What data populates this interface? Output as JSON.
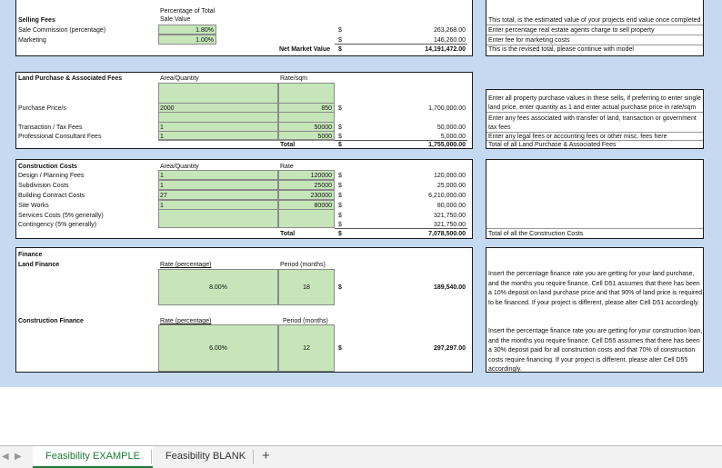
{
  "selling": {
    "col_header": [
      "Percentage of Total",
      "Sale Value"
    ],
    "title": "Selling Fees",
    "rows": [
      {
        "label": "Sale Commission (percentage)",
        "rate": "1.80%",
        "cur": "$",
        "amount": "263,268.00",
        "note": "Enter percentage real estate agents charge to sell property"
      },
      {
        "label": "Marketing",
        "rate": "1.00%",
        "cur": "$",
        "amount": "146,260.00",
        "note": "Enter fee for marketing costs"
      }
    ],
    "total_label": "Net Market Value",
    "total_cur": "$",
    "total_amount": "14,191,472.00",
    "total_note": "This is the revised total, please continue with model",
    "top_note": "This total, is the estimated value of your projects end value once completed"
  },
  "land": {
    "title": "Land Purchase & Associated Fees",
    "col_qty": "Area/Quantity",
    "col_rate": "Rate/sqm",
    "rows": [
      {
        "label": "Purchase Price/s",
        "qty": "2000",
        "rate": "850",
        "cur": "$",
        "amount": "1,700,000.00"
      },
      {
        "label": "Transaction / Tax Fees",
        "qty": "1",
        "rate": "50000",
        "cur": "$",
        "amount": "50,000.00"
      },
      {
        "label": "Professional Consultant Fees",
        "qty": "1",
        "rate": "5000",
        "cur": "$",
        "amount": "5,000.00"
      }
    ],
    "total_label": "Total",
    "total_cur": "$",
    "total_amount": "1,755,000.00",
    "notes": [
      "Enter all property purchase values in these sells, if preferring to enter single",
      "land price, enter quantity as 1 and enter actual purchase price in rate/sqm",
      "Enter any fees associated with transfer of land, transaction or government",
      "tax fees",
      "Enter any legal fees or accounting fees or other misc. fees here",
      "Total of all Land Purchase & Associated Fees"
    ]
  },
  "construction": {
    "title": "Construction Costs",
    "col_qty": "Area/Quantity",
    "col_rate": "Rate",
    "rows": [
      {
        "label": "Design / Planning Fees",
        "qty": "1",
        "rate": "120000",
        "cur": "$",
        "amount": "120,000.00"
      },
      {
        "label": "Subdivision Costs",
        "qty": "1",
        "rate": "25000",
        "cur": "$",
        "amount": "25,000.00"
      },
      {
        "label": "Building Contract Costs",
        "qty": "27",
        "rate": "230000",
        "cur": "$",
        "amount": "6,210,000.00"
      },
      {
        "label": "Site Works",
        "qty": "1",
        "rate": "80000",
        "cur": "$",
        "amount": "80,000.00"
      },
      {
        "label": "Services Costs (5% generally)",
        "qty": "",
        "rate": "",
        "cur": "$",
        "amount": "321,750.00"
      },
      {
        "label": "Contingency (5% generally)",
        "qty": "",
        "rate": "",
        "cur": "$",
        "amount": "321,750.00"
      }
    ],
    "total_label": "Total",
    "total_cur": "$",
    "total_amount": "7,078,500.00",
    "total_note": "Total of all the Construction Costs"
  },
  "finance": {
    "title": "Finance",
    "land": {
      "title": "Land Finance",
      "col_rate": "Rate (percentage)",
      "col_period": "Period (months)",
      "rate": "8.00%",
      "period": "18",
      "cur": "$",
      "amount": "189,540.00",
      "note": "Insert the percentage finance rate you are getting for your land purchase, and the months you require finance. Cell D51 assumes that there has been a 10% deposit on land purchase price and that 90% of land price is required to be financed. If your project is different, please alter Cell D51 accordingly."
    },
    "construction": {
      "title": "Construction Finance",
      "col_rate": "Rate (percentage)",
      "col_period": "Period (months)",
      "rate": "6.00%",
      "period": "12",
      "cur": "$",
      "amount": "297,297.00",
      "note": "Insert the percentage finance rate you are getting for your construction loan, and the months you require finance. Cell D55 assumes that there has been a 30% deposit paid for all construction costs and that 70% of construction costs require financing. If your project is different, please alter Cell D55 accordingly."
    }
  },
  "tabs": {
    "prev": "◀",
    "next": "▶",
    "active": "Feasibility EXAMPLE",
    "inactive": "Feasibility BLANK",
    "add": "+"
  },
  "colors": {
    "input_green": "#c6e6b9",
    "background_blue": "#c5daf0",
    "tab_green": "#1f7a3a"
  }
}
